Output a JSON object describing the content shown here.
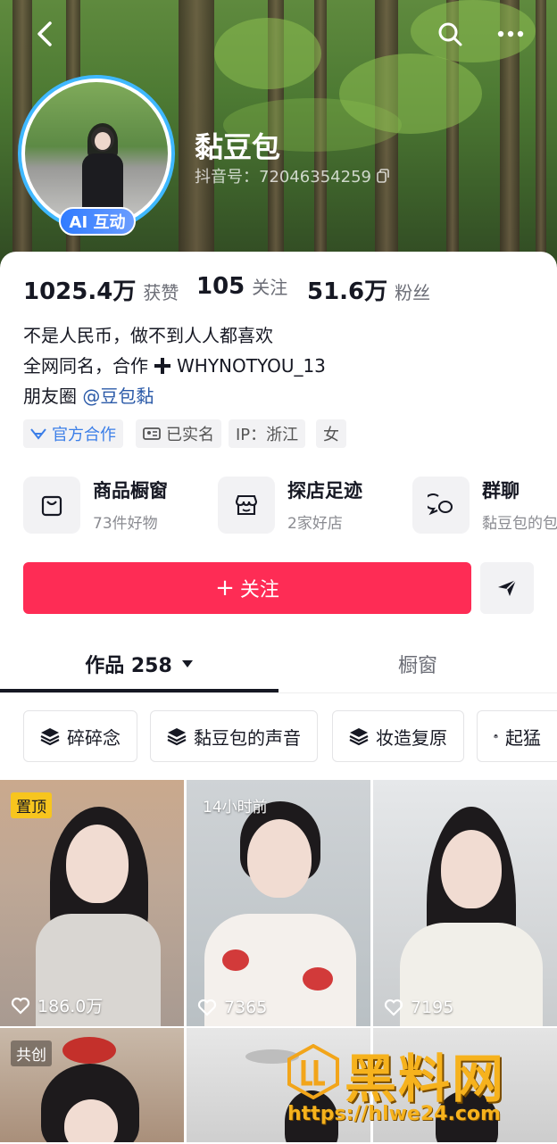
{
  "header": {
    "name": "黏豆包",
    "douyin_id": "抖音号：72046354259",
    "ai_badge": "AI 互动",
    "icons": [
      "back-icon",
      "search-icon",
      "more-icon",
      "copy-icon"
    ]
  },
  "stats": [
    {
      "value": "1025.4万",
      "label": "获赞"
    },
    {
      "value": "105",
      "label": "关注"
    },
    {
      "value": "51.6万",
      "label": "粉丝"
    }
  ],
  "bio": {
    "line1": "不是人民币，做不到人人都喜欢",
    "line2_prefix": "全网同名，合作",
    "line2_suffix": "WHYNOTYOU_13",
    "line3_prefix": "朋友圈",
    "line3_mention": "@豆包黏"
  },
  "tags": {
    "official": "官方合作",
    "verified": "已实名",
    "ip": "IP：浙江",
    "gender": "女"
  },
  "services": [
    {
      "title": "商品橱窗",
      "sub": "73件好物",
      "icon": "shopping-bag-icon"
    },
    {
      "title": "探店足迹",
      "sub": "2家好店",
      "icon": "store-icon"
    },
    {
      "title": "群聊",
      "sub": "黏豆包的包",
      "icon": "chat-icon"
    }
  ],
  "actions": {
    "follow": "关注",
    "follow_plus": "+"
  },
  "tabs": {
    "works": "作品 258",
    "showcase": "橱窗"
  },
  "collections": [
    "碎碎念",
    "黏豆包的声音",
    "妆造复原",
    "起猛"
  ],
  "videos": [
    {
      "badge": "置顶",
      "likes": "186.0万"
    },
    {
      "badge": "14小时前",
      "likes": "7365"
    },
    {
      "badge": "",
      "likes": "7195"
    },
    {
      "badge": "共创",
      "likes": ""
    },
    {
      "badge": "",
      "likes": ""
    },
    {
      "badge": "",
      "likes": ""
    }
  ],
  "watermark": {
    "logo_text": "黑料网",
    "url": "https://hlwe24.com"
  },
  "colors": {
    "accent": "#fe2c55",
    "link": "#2b5aa8",
    "official_tag": "#3b7ee8",
    "avatar_ring": "#3fb8ff",
    "pinned_badge": "#f7c51e"
  }
}
